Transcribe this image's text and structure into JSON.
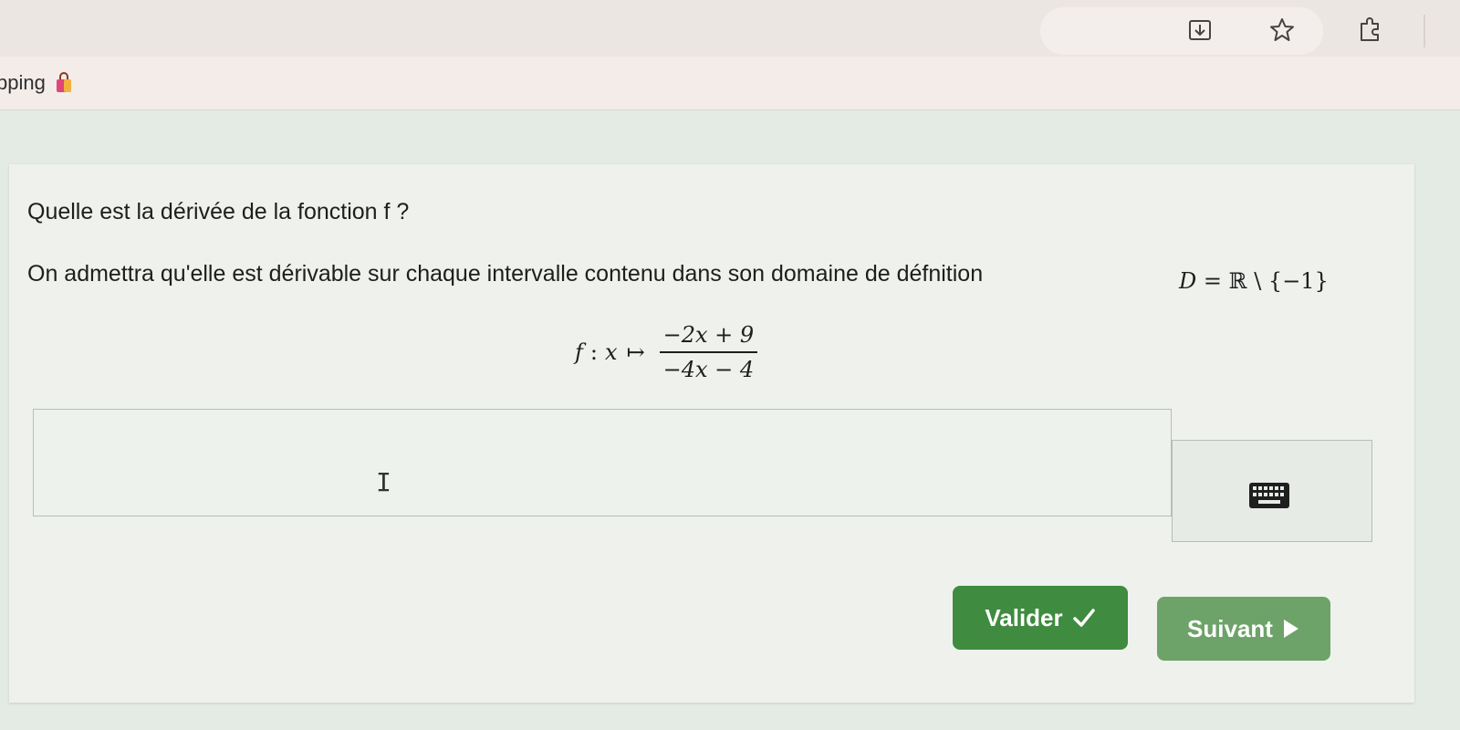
{
  "browser": {
    "bookmark_label": "pping",
    "icons": [
      "download-icon",
      "star-icon",
      "extension-icon",
      "shopping-bag-icon"
    ]
  },
  "exercise": {
    "question": "Quelle est la dérivée de la fonction f ?",
    "instruction": "On admettra qu'elle est dérivable sur chaque intervalle contenu dans son domaine de défnition",
    "domain_var": "D",
    "domain_set": "= ℝ \\ {−1}",
    "function_name": "f",
    "function_colon": ":",
    "function_var": "x",
    "maps_to": "↦",
    "numerator": "−2x + 9",
    "denominator": "−4x − 4"
  },
  "answer": {
    "value": "",
    "placeholder": ""
  },
  "buttons": {
    "valider": "Valider",
    "suivant": "Suivant"
  },
  "colors": {
    "valider_bg": "#3f8b3f",
    "suivant_bg": "#6da269",
    "card_bg": "#eef1ec"
  }
}
